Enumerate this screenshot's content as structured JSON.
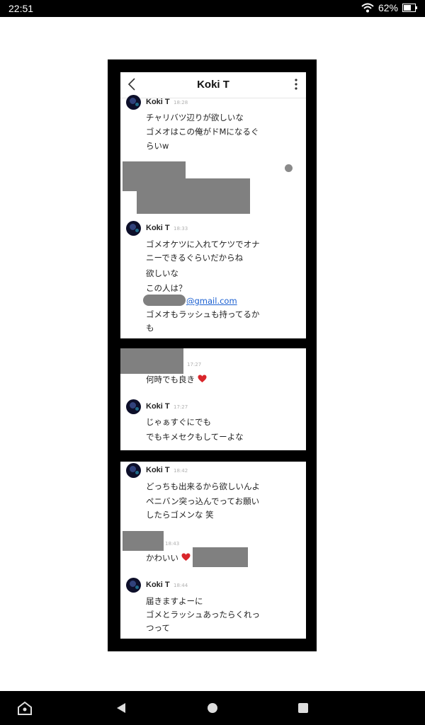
{
  "status_bar": {
    "time": "22:51",
    "battery": "62%"
  },
  "panel1": {
    "header_title": "Koki T",
    "sender": "Koki T",
    "ts1": "18:28",
    "msg1_line1": "チャリバツ辺りが欲しいな",
    "msg1_line2": "ゴメオはこの俺がドMになるぐ",
    "msg1_line3": "らいw",
    "ts2": "18:33",
    "msg2_line1": "ゴメオケツに入れてケツでオナ",
    "msg2_line2": "ニーできるぐらいだからね",
    "msg3": "欲しいな",
    "msg4": "この人は？",
    "email_suffix": "@gmail.com",
    "msg5_line1": "ゴメオもラッシュも持ってるか",
    "msg5_line2": "も"
  },
  "panel2": {
    "ts1": "17:27",
    "msg1": "何時でも良き",
    "sender": "Koki T",
    "ts2": "17:27",
    "msg2_line1": "じゃぁすぐにでも",
    "msg2_line2": "でもキメセクもしてーよな"
  },
  "panel3": {
    "sender": "Koki T",
    "ts1": "18:42",
    "msg1_line1": "どっちも出来るから欲しいんよ",
    "msg1_line2": "ペニバン突っ込んでってお願い",
    "msg1_line3": "したらゴメンな 笑",
    "ts2": "18:43",
    "msg2": "かわいい",
    "sender2": "Koki T",
    "ts3": "18:44",
    "msg3_line1": "届きますよーに",
    "msg3_line2": "ゴメとラッシュあったらくれっ",
    "msg3_line3": "つって"
  },
  "icons": {
    "back": "chevron-left-icon",
    "more": "more-vertical-icon",
    "heart": "heart-icon",
    "wifi": "wifi-icon",
    "battery": "battery-icon",
    "nav_home": "home-icon",
    "nav_back": "back-triangle-icon",
    "nav_circle": "home-circle-icon",
    "nav_recents": "recents-square-icon"
  },
  "colors": {
    "heart": "#d9262b",
    "link": "#1a5fd1",
    "redaction": "#808080"
  }
}
